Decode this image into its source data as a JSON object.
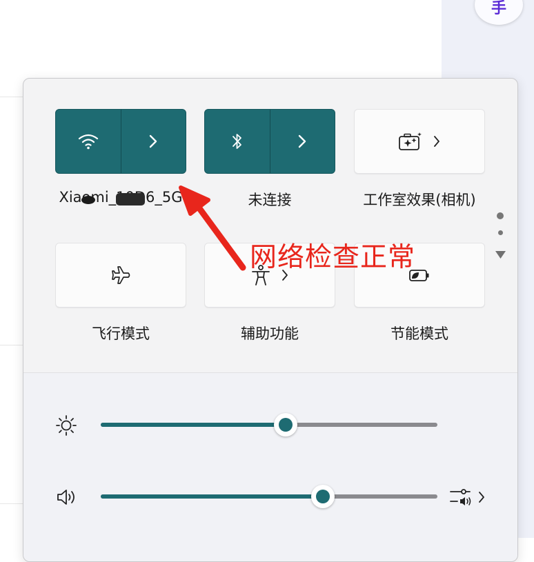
{
  "background": {
    "ime_indicator": "手"
  },
  "tiles": [
    {
      "id": "wifi",
      "label": "Xiaomi_10D6_5G",
      "state": "on",
      "left_icon": "wifi-icon",
      "right_icon": "chevron-right-icon"
    },
    {
      "id": "bluetooth",
      "label": "未连接",
      "state": "on",
      "left_icon": "bluetooth-icon",
      "right_icon": "chevron-right-icon"
    },
    {
      "id": "studio-effects",
      "label": "工作室效果(相机)",
      "state": "off",
      "icon": "camera-sparkle-icon",
      "chevron": "chevron-right-icon"
    },
    {
      "id": "airplane",
      "label": "飞行模式",
      "state": "off",
      "icon": "airplane-icon"
    },
    {
      "id": "accessibility",
      "label": "辅助功能",
      "state": "off",
      "icon": "accessibility-person-icon",
      "chevron": "chevron-right-icon"
    },
    {
      "id": "energy-saver",
      "label": "节能模式",
      "state": "off",
      "icon": "battery-leaf-icon"
    }
  ],
  "sliders": {
    "brightness": {
      "icon": "sun-icon",
      "value": 0.55
    },
    "volume": {
      "icon": "speaker-icon",
      "value": 0.66,
      "right_icon": "audio-output-icon",
      "right_chevron": "chevron-right-icon"
    }
  },
  "annotation": {
    "text": "网络检查正常",
    "color": "#e8261c"
  },
  "colors": {
    "accent": "#1e6b72",
    "annotation": "#e8261c"
  }
}
